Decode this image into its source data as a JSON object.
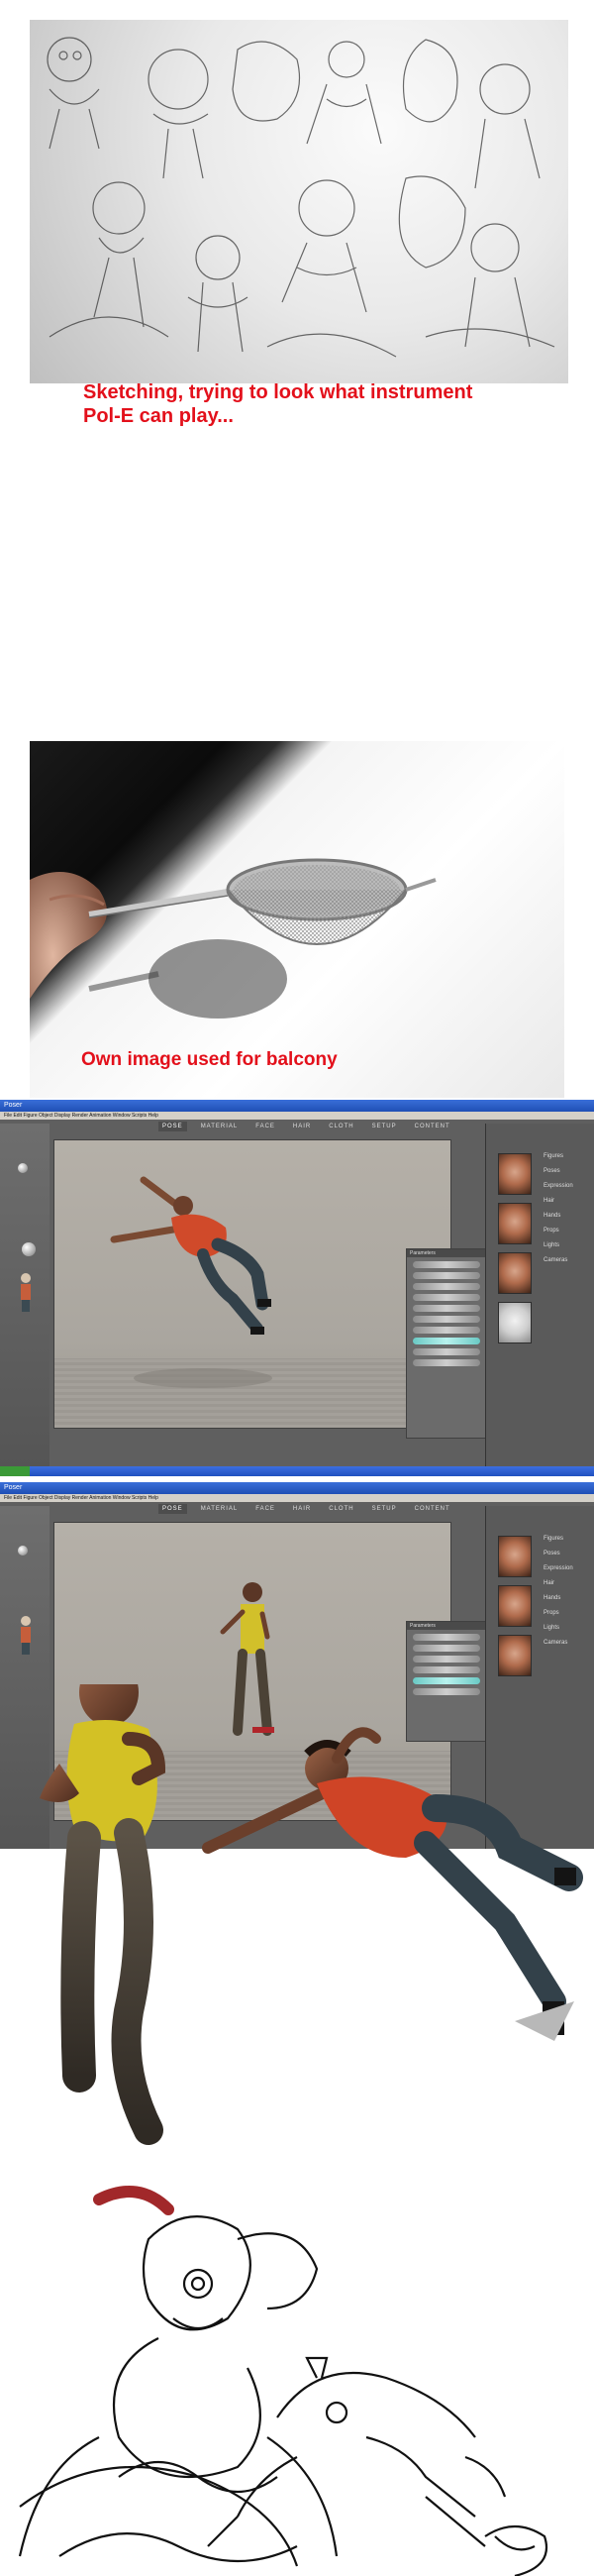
{
  "captions": {
    "sketching_line1": "Sketching, trying to look what instrument",
    "sketching_line2": "Pol-E can play...",
    "balcony": "Own image used for balcony"
  },
  "colors": {
    "caption": "#e3101b",
    "poser_bg": "#5f5f5f",
    "viewport": "#b0aba3"
  },
  "poser": {
    "tabs": [
      "POSE",
      "MATERIAL",
      "FACE",
      "HAIR",
      "CLOTH",
      "SETUP",
      "CONTENT"
    ],
    "menu": "File  Edit  Figure  Object  Display  Render  Animation  Window  Scripts  Help",
    "side_labels": [
      "Figures",
      "Poses",
      "Expression",
      "Hair",
      "Hands",
      "Props",
      "Lights",
      "Cameras"
    ]
  }
}
